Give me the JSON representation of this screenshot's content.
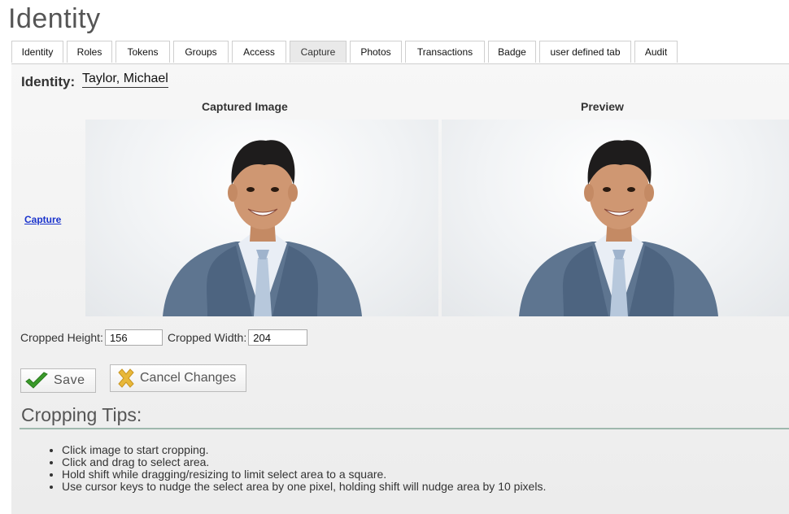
{
  "page": {
    "title": "Identity"
  },
  "tabs": [
    {
      "label": "Identity",
      "active": false
    },
    {
      "label": "Roles",
      "active": false
    },
    {
      "label": "Tokens",
      "active": false
    },
    {
      "label": "Groups",
      "active": false
    },
    {
      "label": "Access",
      "active": false
    },
    {
      "label": "Capture",
      "active": true
    },
    {
      "label": "Photos",
      "active": false
    },
    {
      "label": "Transactions",
      "active": false
    },
    {
      "label": "Badge",
      "active": false
    },
    {
      "label": "user defined tab",
      "active": false
    },
    {
      "label": "Audit",
      "active": false
    }
  ],
  "identity": {
    "label": "Identity:",
    "name": "Taylor, Michael"
  },
  "capture": {
    "link_label": "Capture",
    "captured_heading": "Captured Image",
    "preview_heading": "Preview"
  },
  "crop": {
    "height_label": "Cropped Height:",
    "height_value": "156",
    "width_label": "Cropped Width:",
    "width_value": "204"
  },
  "buttons": {
    "save": "Save",
    "cancel": "Cancel Changes"
  },
  "tips": {
    "title": "Cropping Tips:",
    "items": [
      "Click image to start cropping.",
      "Click and drag to select area.",
      "Hold shift while dragging/resizing to limit select area to a square.",
      "Use cursor keys to nudge the select area by one pixel, holding shift will nudge area by 10 pixels."
    ]
  },
  "colors": {
    "link": "#1a33cc",
    "save_check": "#3a9a2a",
    "cancel_icon": "#e8b83a",
    "tips_rule": "#9fb8ad"
  },
  "icons": {
    "save": "checkmark-icon",
    "cancel": "cancel-x-icon"
  }
}
